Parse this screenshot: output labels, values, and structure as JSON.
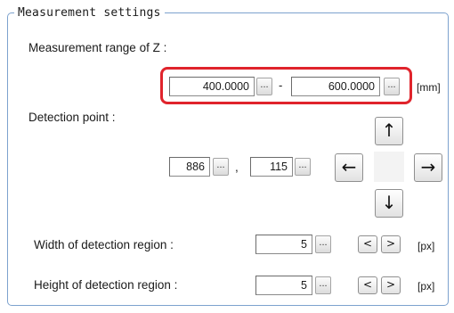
{
  "group": {
    "title": "Measurement settings"
  },
  "z_range": {
    "label": "Measurement range of Z :",
    "min": "400.0000",
    "separator": "-",
    "max": "600.0000",
    "unit": "[mm]"
  },
  "detection_point": {
    "label": "Detection point :",
    "x": "886",
    "separator": ",",
    "y": "115",
    "up": "↑",
    "left": "←",
    "right": "→",
    "down": "↓"
  },
  "width_region": {
    "label": "Width of detection region :",
    "value": "5",
    "dec": "<",
    "inc": ">",
    "unit": "[px]"
  },
  "height_region": {
    "label": "Height of detection region :",
    "value": "5",
    "dec": "<",
    "inc": ">",
    "unit": "[px]"
  },
  "dots_label": "..."
}
